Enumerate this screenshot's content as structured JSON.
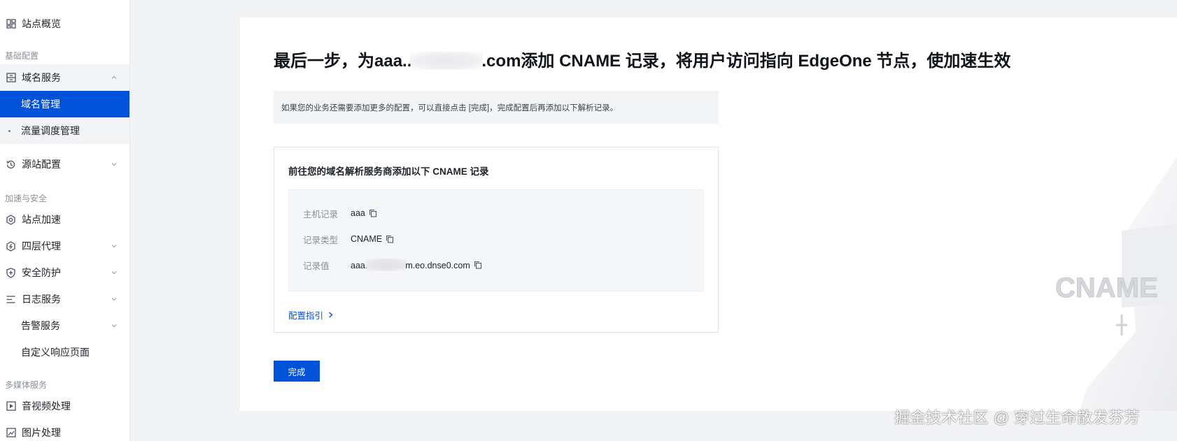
{
  "sidebar": {
    "overview": "站点概览",
    "groups": {
      "basic": "基础配置",
      "accel_security": "加速与安全",
      "media": "多媒体服务"
    },
    "domain_service": "域名服务",
    "domain_manage": "域名管理",
    "traffic_schedule": "流量调度管理",
    "origin_config": "源站配置",
    "site_accel": "站点加速",
    "l4_proxy": "四层代理",
    "security": "安全防护",
    "log_service": "日志服务",
    "alarm_service": "告警服务",
    "custom_page": "自定义响应页面",
    "av_process": "音视频处理",
    "image_process": "图片处理"
  },
  "main": {
    "title_before": "最后一步，为aaa..",
    "title_after": ".com添加 CNAME 记录，将用户访问指向 EdgeOne 节点，使加速生效",
    "notice": "如果您的业务还需要添加更多的配置，可以直接点击 [完成]，完成配置后再添加以下解析记录。",
    "panel_title": "前往您的域名解析服务商添加以下 CNAME 记录",
    "records": {
      "host_label": "主机记录",
      "host_value": "aaa",
      "type_label": "记录类型",
      "type_value": "CNAME",
      "value_label": "记录值",
      "value_prefix": "aaa.",
      "value_suffix": "m.eo.dnse0.com"
    },
    "guide_link": "配置指引",
    "done_button": "完成",
    "decoration_text": "CNAME"
  },
  "watermark": "掘金技术社区 @ 穿过生命散发芬芳",
  "colors": {
    "accent": "#0052d9",
    "sidebar_bg": "#ffffff",
    "page_bg": "#f2f3f5"
  },
  "icons": [
    "dashboard-icon",
    "domain-icon",
    "history-icon",
    "site-accel-icon",
    "proxy-icon",
    "shield-icon",
    "log-icon",
    "media-icon",
    "image-icon",
    "copy-icon",
    "chevron-right-icon",
    "chevron-down-icon",
    "chevron-up-icon"
  ]
}
